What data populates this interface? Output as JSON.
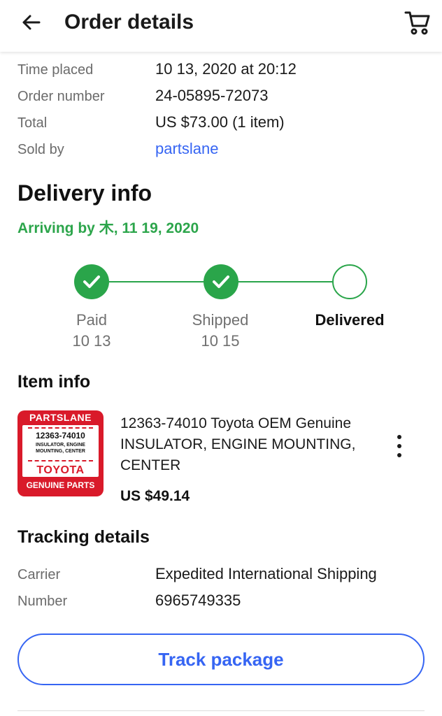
{
  "header": {
    "title": "Order details",
    "back_icon": "arrow-left-icon",
    "cart_icon": "cart-icon"
  },
  "order": {
    "time_placed_label": "Time placed",
    "time_placed_value": "10 13, 2020 at 20:12",
    "order_number_label": "Order number",
    "order_number_value": "24-05895-72073",
    "total_label": "Total",
    "total_value": "US $73.00 (1 item)",
    "sold_by_label": "Sold by",
    "sold_by_value": "partslane"
  },
  "delivery": {
    "title": "Delivery info",
    "arriving": "Arriving by 木, 11 19, 2020",
    "steps": [
      {
        "label": "Paid",
        "date": "10 13",
        "done": true
      },
      {
        "label": "Shipped",
        "date": "10 15",
        "done": true
      },
      {
        "label": "Delivered",
        "date": "",
        "done": false
      }
    ]
  },
  "item": {
    "section_title": "Item info",
    "title": "12363-74010 Toyota OEM Genuine INSULATOR, ENGINE MOUNTING, CENTER",
    "price": "US $49.14",
    "menu_icon": "more-vertical-icon",
    "thumbnail": {
      "brand": "PARTSLANE",
      "part_number": "12363-74010",
      "description_line1": "INSULATOR, ENGINE",
      "description_line2": "MOUNTING, CENTER",
      "make": "TOYOTA",
      "footer": "GENUINE PARTS"
    }
  },
  "tracking": {
    "section_title": "Tracking details",
    "carrier_label": "Carrier",
    "carrier_value": "Expedited International Shipping",
    "number_label": "Number",
    "number_value": "6965749335"
  },
  "actions": {
    "track_label": "Track package"
  },
  "colors": {
    "accent_blue": "#3665f3",
    "success_green": "#2aa54a",
    "brand_red": "#d91a2a"
  }
}
